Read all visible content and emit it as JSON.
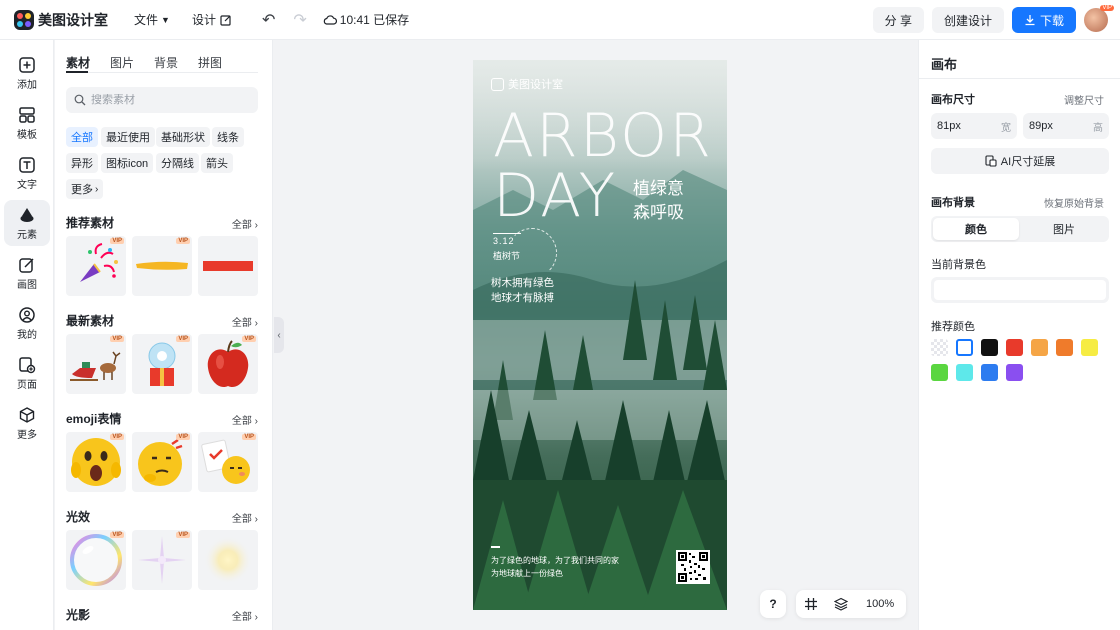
{
  "app": {
    "name": "美图设计室"
  },
  "topbar": {
    "file_menu": "文件",
    "design_menu": "设计",
    "save_status": "10:41 已保存",
    "share_label": "分 享",
    "create_label": "创建设计",
    "download_label": "下载",
    "avatar_badge": "VIP"
  },
  "rail": {
    "items": [
      {
        "label": "添加",
        "icon": "plus-square-icon"
      },
      {
        "label": "模板",
        "icon": "template-icon"
      },
      {
        "label": "文字",
        "icon": "text-icon"
      },
      {
        "label": "元素",
        "icon": "shapes-icon",
        "active": true
      },
      {
        "label": "画图",
        "icon": "pen-edit-icon"
      },
      {
        "label": "我的",
        "icon": "user-icon"
      },
      {
        "label": "页面",
        "icon": "page-add-icon"
      },
      {
        "label": "更多",
        "icon": "cube-icon"
      }
    ]
  },
  "materials": {
    "tabs": [
      "素材",
      "图片",
      "背景",
      "拼图"
    ],
    "active_tab": "素材",
    "search_placeholder": "搜索素材",
    "chips": [
      "全部",
      "最近使用",
      "基础形状",
      "线条",
      "异形",
      "图标icon",
      "分隔线",
      "箭头",
      "更多"
    ],
    "active_chip": "全部",
    "sections": [
      {
        "title": "推荐素材",
        "all": "全部",
        "items": [
          {
            "vip": true,
            "icon": "party-popper-icon"
          },
          {
            "vip": true,
            "icon": "yellow-brush-stroke"
          },
          {
            "vip": false,
            "icon": "red-bar"
          }
        ]
      },
      {
        "title": "最新素材",
        "all": "全部",
        "items": [
          {
            "vip": true,
            "icon": "reindeer-sleigh"
          },
          {
            "vip": true,
            "icon": "snow-globe-gift"
          },
          {
            "vip": true,
            "icon": "red-apple"
          }
        ]
      },
      {
        "title": "emoji表情",
        "all": "全部",
        "items": [
          {
            "vip": true,
            "icon": "shocked-emoji"
          },
          {
            "vip": true,
            "icon": "thinking-emoji"
          },
          {
            "vip": true,
            "icon": "checklist-emoji"
          }
        ]
      },
      {
        "title": "光效",
        "all": "全部",
        "items": [
          {
            "vip": true,
            "icon": "rainbow-bubble"
          },
          {
            "vip": true,
            "icon": "purple-sparkle"
          },
          {
            "vip": false,
            "icon": "yellow-glow"
          }
        ]
      },
      {
        "title": "光影",
        "all": "全部",
        "items": []
      }
    ],
    "vip_label": "VIP"
  },
  "poster": {
    "brand": "美图设计室",
    "title_line1": "ARBOR",
    "title_line2": "DAY",
    "cn_line1": "植绿意",
    "cn_line2": "森呼吸",
    "date": "3.12",
    "festival": "植树节",
    "slogan_line1": "树木拥有绿色",
    "slogan_line2": "地球才有脉搏",
    "footer_line1": "为了绿色的地球，为了我们共同的家",
    "footer_line2": "为地球献上一份绿色"
  },
  "canvas_toolbar": {
    "help": "?",
    "zoom": "100%"
  },
  "right_panel": {
    "title": "画布",
    "size_label": "画布尺寸",
    "resize_link": "调整尺寸",
    "width_value": "81px",
    "width_unit": "宽",
    "height_value": "89px",
    "height_unit": "高",
    "ai_extend": "AI尺寸延展",
    "bg_label": "画布背景",
    "restore_link": "恢复原始背景",
    "seg_color": "颜色",
    "seg_image": "图片",
    "current_bg_label": "当前背景色",
    "current_bg_color": "#ffffff",
    "recommend_label": "推荐颜色",
    "swatches": [
      "transparent",
      "#ffffff",
      "#111111",
      "#e83a2b",
      "#f5a546",
      "#ef7b2b",
      "#f6ec43",
      "#5ad640",
      "#5ee8ea",
      "#2d7cf0",
      "#8a4ff0"
    ]
  }
}
